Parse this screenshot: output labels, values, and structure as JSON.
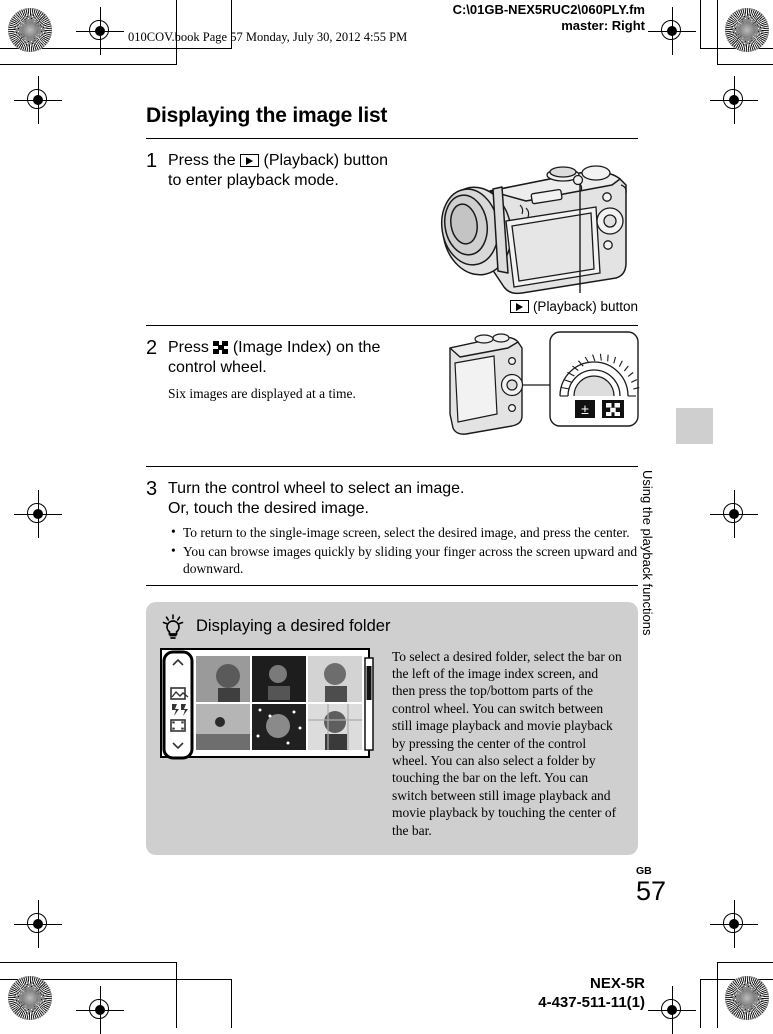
{
  "print_marks": {
    "fm_path_line1": "C:\\01GB-NEX5RUC2\\060PLY.fm",
    "fm_path_line2": "master: Right",
    "book_line": "010COV.book  Page 57  Monday, July 30, 2012  4:55 PM"
  },
  "page": {
    "title": "Displaying the image list",
    "side_tab_label": "Using the playback functions",
    "page_label": "GB",
    "page_number": "57"
  },
  "steps": [
    {
      "number": "1",
      "head_before": "Press the",
      "icon": "playback-icon",
      "head_after": "(Playback) button to enter playback mode.",
      "figure_caption_text": "(Playback) button",
      "figure_caption_icon": "playback-icon"
    },
    {
      "number": "2",
      "head_before": "Press",
      "icon": "image-index-icon",
      "head_after": "(Image Index) on the control wheel.",
      "sub": "Six images are displayed at a time."
    },
    {
      "number": "3",
      "head_line1": "Turn the control wheel to select an image.",
      "head_line2": "Or, touch the desired image.",
      "bullets": [
        "To return to the single-image screen, select the desired image, and press the center.",
        "You can browse images quickly by sliding your finger across the screen upward and downward."
      ]
    }
  ],
  "tip": {
    "icon": "lightbulb-icon",
    "title": "Displaying a desired folder",
    "text": "To select a desired folder, select the bar on the left of the image index screen, and then press the top/bottom parts of the control wheel. You can switch between still image playback and movie playback by pressing the center of the control wheel. You can also select a folder by touching the bar on the left. You can switch between still image playback and movie playback by touching the center of the bar.",
    "screen_bar_icons": [
      "chevron-up-icon",
      "still-image-icon",
      "aps-icon",
      "movie-film-icon",
      "chevron-down-icon"
    ]
  },
  "footer": {
    "model": "NEX-5R",
    "part_number": "4-437-511-11(1)"
  },
  "colors": {
    "tip_background": "#cfcfcf",
    "rule": "#000000",
    "page_background": "#ffffff"
  }
}
